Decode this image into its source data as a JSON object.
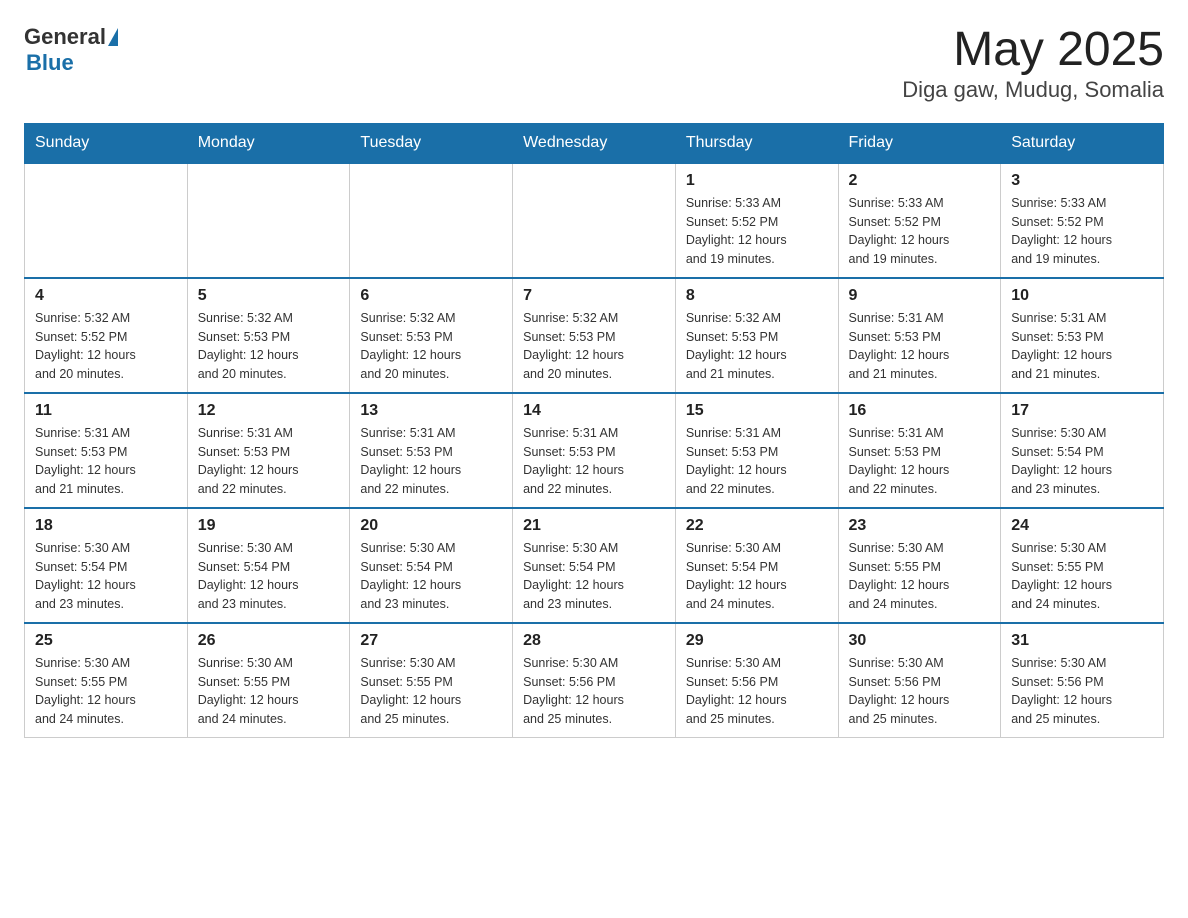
{
  "header": {
    "logo_general": "General",
    "logo_blue": "Blue",
    "title": "May 2025",
    "subtitle": "Diga gaw, Mudug, Somalia"
  },
  "days_of_week": [
    "Sunday",
    "Monday",
    "Tuesday",
    "Wednesday",
    "Thursday",
    "Friday",
    "Saturday"
  ],
  "weeks": [
    [
      {
        "day": "",
        "info": ""
      },
      {
        "day": "",
        "info": ""
      },
      {
        "day": "",
        "info": ""
      },
      {
        "day": "",
        "info": ""
      },
      {
        "day": "1",
        "info": "Sunrise: 5:33 AM\nSunset: 5:52 PM\nDaylight: 12 hours\nand 19 minutes."
      },
      {
        "day": "2",
        "info": "Sunrise: 5:33 AM\nSunset: 5:52 PM\nDaylight: 12 hours\nand 19 minutes."
      },
      {
        "day": "3",
        "info": "Sunrise: 5:33 AM\nSunset: 5:52 PM\nDaylight: 12 hours\nand 19 minutes."
      }
    ],
    [
      {
        "day": "4",
        "info": "Sunrise: 5:32 AM\nSunset: 5:52 PM\nDaylight: 12 hours\nand 20 minutes."
      },
      {
        "day": "5",
        "info": "Sunrise: 5:32 AM\nSunset: 5:53 PM\nDaylight: 12 hours\nand 20 minutes."
      },
      {
        "day": "6",
        "info": "Sunrise: 5:32 AM\nSunset: 5:53 PM\nDaylight: 12 hours\nand 20 minutes."
      },
      {
        "day": "7",
        "info": "Sunrise: 5:32 AM\nSunset: 5:53 PM\nDaylight: 12 hours\nand 20 minutes."
      },
      {
        "day": "8",
        "info": "Sunrise: 5:32 AM\nSunset: 5:53 PM\nDaylight: 12 hours\nand 21 minutes."
      },
      {
        "day": "9",
        "info": "Sunrise: 5:31 AM\nSunset: 5:53 PM\nDaylight: 12 hours\nand 21 minutes."
      },
      {
        "day": "10",
        "info": "Sunrise: 5:31 AM\nSunset: 5:53 PM\nDaylight: 12 hours\nand 21 minutes."
      }
    ],
    [
      {
        "day": "11",
        "info": "Sunrise: 5:31 AM\nSunset: 5:53 PM\nDaylight: 12 hours\nand 21 minutes."
      },
      {
        "day": "12",
        "info": "Sunrise: 5:31 AM\nSunset: 5:53 PM\nDaylight: 12 hours\nand 22 minutes."
      },
      {
        "day": "13",
        "info": "Sunrise: 5:31 AM\nSunset: 5:53 PM\nDaylight: 12 hours\nand 22 minutes."
      },
      {
        "day": "14",
        "info": "Sunrise: 5:31 AM\nSunset: 5:53 PM\nDaylight: 12 hours\nand 22 minutes."
      },
      {
        "day": "15",
        "info": "Sunrise: 5:31 AM\nSunset: 5:53 PM\nDaylight: 12 hours\nand 22 minutes."
      },
      {
        "day": "16",
        "info": "Sunrise: 5:31 AM\nSunset: 5:53 PM\nDaylight: 12 hours\nand 22 minutes."
      },
      {
        "day": "17",
        "info": "Sunrise: 5:30 AM\nSunset: 5:54 PM\nDaylight: 12 hours\nand 23 minutes."
      }
    ],
    [
      {
        "day": "18",
        "info": "Sunrise: 5:30 AM\nSunset: 5:54 PM\nDaylight: 12 hours\nand 23 minutes."
      },
      {
        "day": "19",
        "info": "Sunrise: 5:30 AM\nSunset: 5:54 PM\nDaylight: 12 hours\nand 23 minutes."
      },
      {
        "day": "20",
        "info": "Sunrise: 5:30 AM\nSunset: 5:54 PM\nDaylight: 12 hours\nand 23 minutes."
      },
      {
        "day": "21",
        "info": "Sunrise: 5:30 AM\nSunset: 5:54 PM\nDaylight: 12 hours\nand 23 minutes."
      },
      {
        "day": "22",
        "info": "Sunrise: 5:30 AM\nSunset: 5:54 PM\nDaylight: 12 hours\nand 24 minutes."
      },
      {
        "day": "23",
        "info": "Sunrise: 5:30 AM\nSunset: 5:55 PM\nDaylight: 12 hours\nand 24 minutes."
      },
      {
        "day": "24",
        "info": "Sunrise: 5:30 AM\nSunset: 5:55 PM\nDaylight: 12 hours\nand 24 minutes."
      }
    ],
    [
      {
        "day": "25",
        "info": "Sunrise: 5:30 AM\nSunset: 5:55 PM\nDaylight: 12 hours\nand 24 minutes."
      },
      {
        "day": "26",
        "info": "Sunrise: 5:30 AM\nSunset: 5:55 PM\nDaylight: 12 hours\nand 24 minutes."
      },
      {
        "day": "27",
        "info": "Sunrise: 5:30 AM\nSunset: 5:55 PM\nDaylight: 12 hours\nand 25 minutes."
      },
      {
        "day": "28",
        "info": "Sunrise: 5:30 AM\nSunset: 5:56 PM\nDaylight: 12 hours\nand 25 minutes."
      },
      {
        "day": "29",
        "info": "Sunrise: 5:30 AM\nSunset: 5:56 PM\nDaylight: 12 hours\nand 25 minutes."
      },
      {
        "day": "30",
        "info": "Sunrise: 5:30 AM\nSunset: 5:56 PM\nDaylight: 12 hours\nand 25 minutes."
      },
      {
        "day": "31",
        "info": "Sunrise: 5:30 AM\nSunset: 5:56 PM\nDaylight: 12 hours\nand 25 minutes."
      }
    ]
  ]
}
